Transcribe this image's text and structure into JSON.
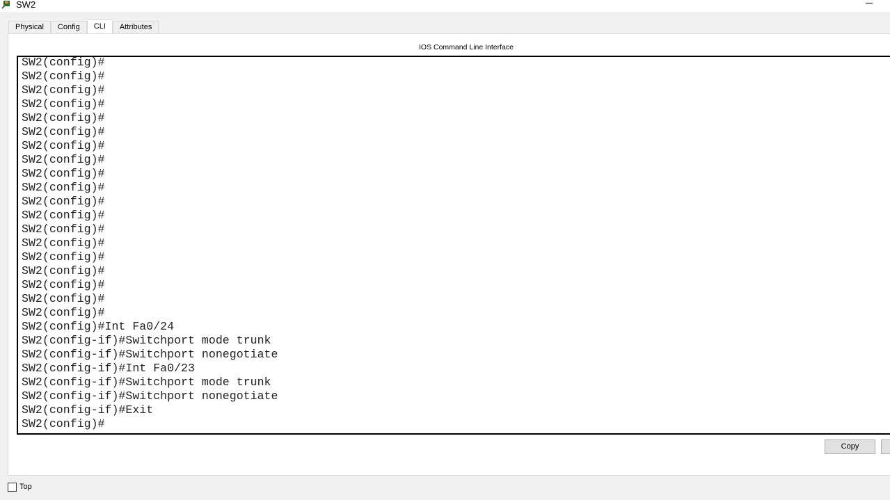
{
  "window": {
    "title": "SW2",
    "icon": "switch-app-icon"
  },
  "tabs": [
    {
      "label": "Physical"
    },
    {
      "label": "Config"
    },
    {
      "label": "CLI",
      "active": true
    },
    {
      "label": "Attributes"
    }
  ],
  "cli": {
    "label": "IOS Command Line Interface",
    "lines": [
      "SW2(config)#",
      "SW2(config)#",
      "SW2(config)#",
      "SW2(config)#",
      "SW2(config)#",
      "SW2(config)#",
      "SW2(config)#",
      "SW2(config)#",
      "SW2(config)#",
      "SW2(config)#",
      "SW2(config)#",
      "SW2(config)#",
      "SW2(config)#",
      "SW2(config)#",
      "SW2(config)#",
      "SW2(config)#",
      "SW2(config)#",
      "SW2(config)#",
      "SW2(config)#",
      "SW2(config)#Int Fa0/24",
      "SW2(config-if)#Switchport mode trunk",
      "SW2(config-if)#Switchport nonegotiate",
      "SW2(config-if)#Int Fa0/23",
      "SW2(config-if)#Switchport mode trunk",
      "SW2(config-if)#Switchport nonegotiate",
      "SW2(config-if)#Exit",
      "SW2(config)#"
    ]
  },
  "buttons": {
    "copy": "Copy"
  },
  "footer": {
    "top_label": "Top",
    "top_checked": false
  }
}
